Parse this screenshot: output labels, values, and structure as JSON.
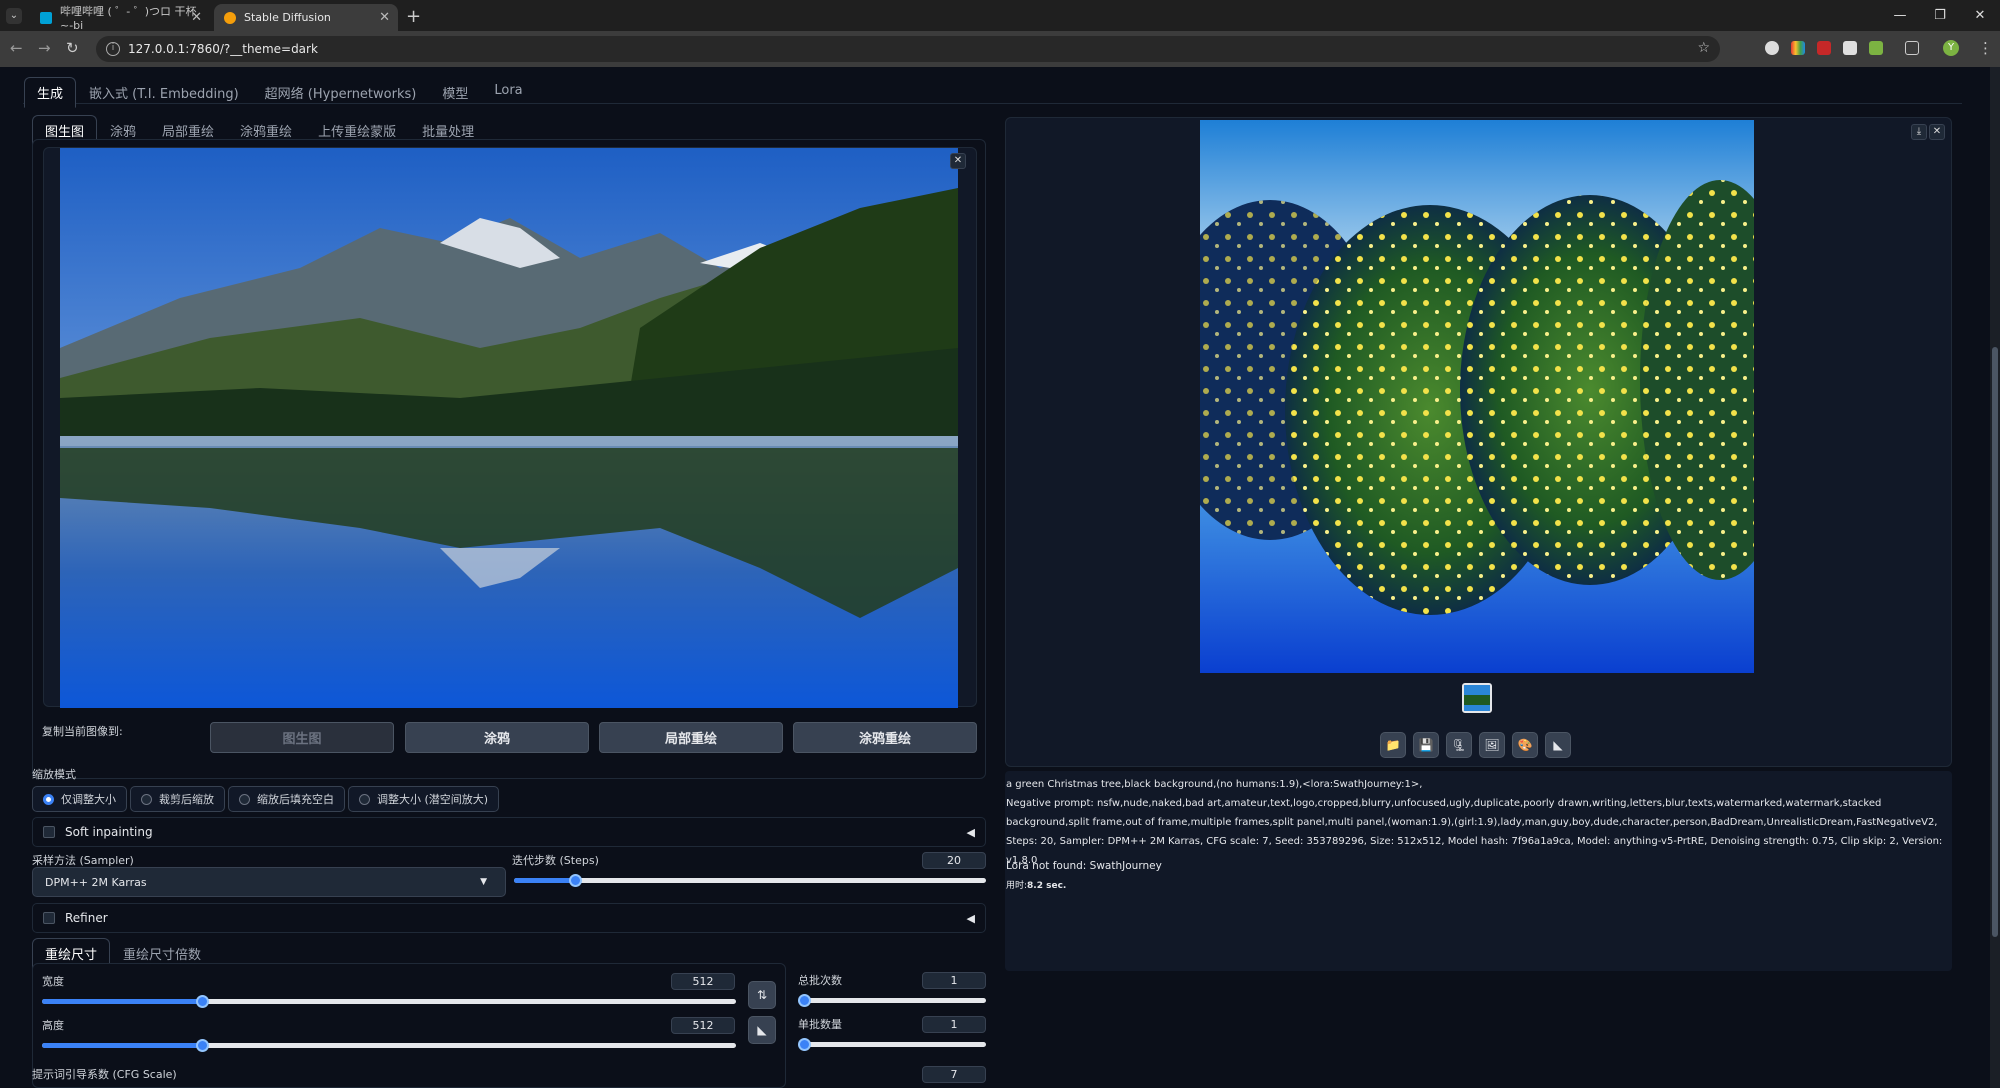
{
  "browser": {
    "tabs": [
      {
        "title": "哔哩哔哩 ( ゜- ゜)つロ 干杯~-bi",
        "favicon_color": "#00a1d6"
      },
      {
        "title": "Stable Diffusion",
        "favicon_color": "#f59e0b"
      }
    ],
    "url": "127.0.0.1:7860/?__theme=dark",
    "new_tab_glyph": "+",
    "window_controls": [
      "—",
      "❐",
      "✕"
    ],
    "profile_initial": "Y"
  },
  "main_tabs": [
    "生成",
    "嵌入式 (T.I. Embedding)",
    "超网络 (Hypernetworks)",
    "模型",
    "Lora"
  ],
  "img2img_tabs": [
    "图生图",
    "涂鸦",
    "局部重绘",
    "涂鸦重绘",
    "上传重绘蒙版",
    "批量处理"
  ],
  "copy_to": {
    "label": "复制当前图像到:",
    "buttons": [
      "图生图",
      "涂鸦",
      "局部重绘",
      "涂鸦重绘"
    ]
  },
  "resize_mode": {
    "label": "缩放模式",
    "options": [
      "仅调整大小",
      "裁剪后缩放",
      "缩放后填充空白",
      "调整大小 (潜空间放大)"
    ],
    "selected": 0
  },
  "soft_inpainting": {
    "label": "Soft inpainting",
    "arrow": "◀"
  },
  "sampler": {
    "label": "采样方法 (Sampler)",
    "value": "DPM++ 2M Karras",
    "caret": "▼"
  },
  "steps": {
    "label": "迭代步数 (Steps)",
    "value": "20",
    "fraction": 0.13
  },
  "refiner": {
    "label": "Refiner",
    "arrow": "◀"
  },
  "size_tabs": [
    "重绘尺寸",
    "重绘尺寸倍数"
  ],
  "width": {
    "label": "宽度",
    "value": "512",
    "fraction": 0.23
  },
  "height": {
    "label": "高度",
    "value": "512",
    "fraction": 0.23
  },
  "swap_icon": "⇅",
  "ratio_icon": "◣",
  "batch_count": {
    "label": "总批次数",
    "value": "1",
    "fraction": 0.0
  },
  "batch_size": {
    "label": "单批数量",
    "value": "1",
    "fraction": 0.0
  },
  "cfg": {
    "label": "提示词引导系数 (CFG Scale)",
    "value": "7"
  },
  "close_glyph": "✕",
  "download_glyph": "⤓",
  "output_tool_icons": [
    "folder-icon",
    "save-icon",
    "zip-icon",
    "image-icon",
    "palette-icon",
    "ruler-icon"
  ],
  "output_tool_glyphs": [
    "📁",
    "💾",
    "🗜",
    "🖼",
    "🎨",
    "◣"
  ],
  "info": {
    "prompt": "a green Christmas tree,black background,(no humans:1.9),<lora:SwathJourney:1>,",
    "negative": "Negative prompt: nsfw,nude,naked,bad art,amateur,text,logo,cropped,blurry,unfocused,ugly,duplicate,poorly drawn,writing,letters,blur,texts,watermarked,watermark,stacked background,split frame,out of frame,multiple frames,split panel,multi panel,(woman:1.9),(girl:1.9),lady,man,guy,boy,dude,character,person,BadDream,UnrealisticDream,FastNegativeV2,",
    "params": "Steps: 20, Sampler: DPM++ 2M Karras, CFG scale: 7, Seed: 353789296, Size: 512x512, Model hash: 7f96a1a9ca, Model: anything-v5-PrtRE, Denoising strength: 0.75, Clip skip: 2, Version: v1.8.0",
    "lora_msg": "Lora not found: SwathJourney",
    "time_label": "用时:",
    "time_value": "8.2 sec."
  },
  "colors": {
    "accent": "#3b82f6",
    "bg": "#0b0f19",
    "panel": "#111827",
    "border": "#1f2937"
  }
}
